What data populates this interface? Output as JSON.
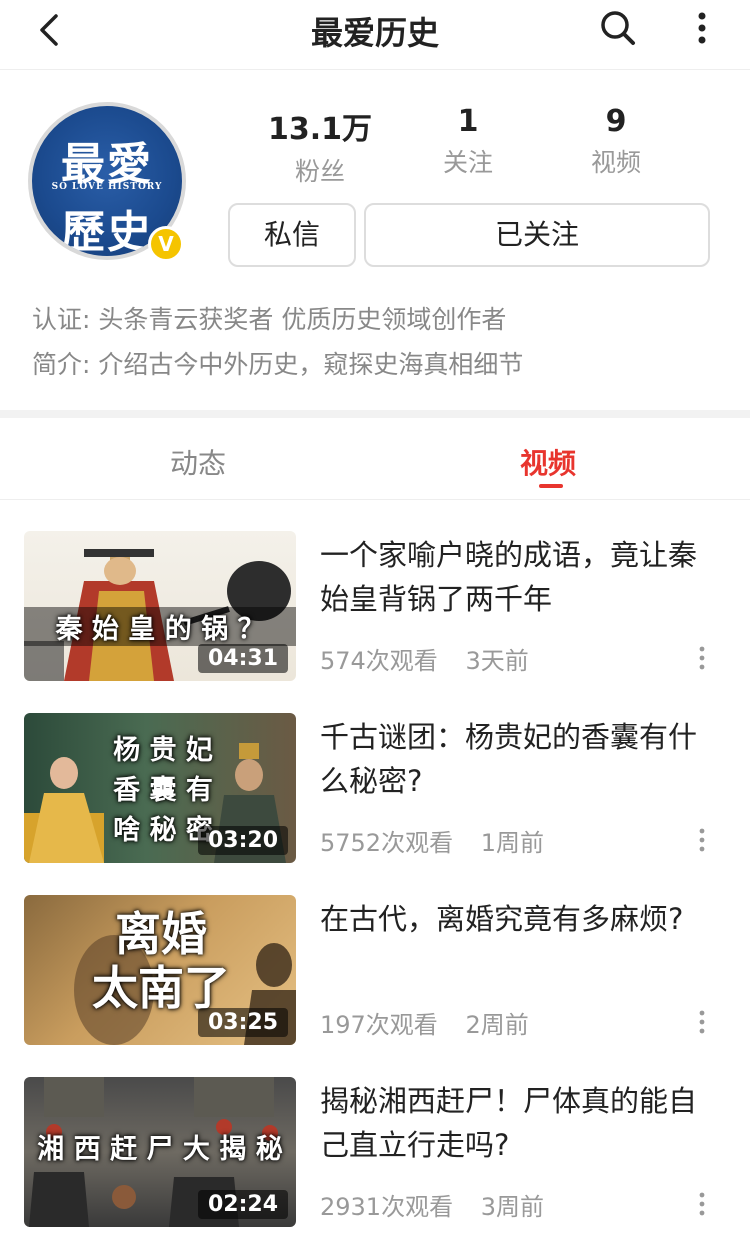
{
  "header": {
    "title": "最爱历史"
  },
  "profile": {
    "avatar": {
      "line1": "最愛",
      "line2": "SO LOVE HISTORY",
      "line3": "歷史",
      "badge": "V"
    },
    "stats": [
      {
        "value": "13.1万",
        "label": "粉丝"
      },
      {
        "value": "1",
        "label": "关注"
      },
      {
        "value": "9",
        "label": "视频"
      }
    ],
    "message_button": "私信",
    "follow_button": "已关注",
    "cert_label": "认证:",
    "cert_value": "头条青云获奖者 优质历史领域创作者",
    "intro_label": "简介:",
    "intro_value": "介绍古今中外历史，窥探史海真相细节"
  },
  "tabs": [
    {
      "label": "动态",
      "active": false
    },
    {
      "label": "视频",
      "active": true
    }
  ],
  "videos": [
    {
      "thumb_text": "秦 始 皇 的 锅 ？",
      "duration": "04:31",
      "title": "一个家喻户晓的成语，竟让秦始皇背锅了两千年",
      "views": "574次观看",
      "time": "3天前"
    },
    {
      "thumb_text": "杨 贵 妃 香 囊 有 啥 秘 密",
      "thumb_lines": [
        "杨 贵 妃",
        "香 囊 有",
        "啥 秘 密"
      ],
      "duration": "03:20",
      "title": "千古谜团：杨贵妃的香囊有什么秘密?",
      "views": "5752次观看",
      "time": "1周前"
    },
    {
      "thumb_lines": [
        "离婚",
        "太南了"
      ],
      "duration": "03:25",
      "title": "在古代，离婚究竟有多麻烦?",
      "views": "197次观看",
      "time": "2周前"
    },
    {
      "thumb_text": "湘 西 赶 尸 大 揭 秘",
      "duration": "02:24",
      "title": "揭秘湘西赶尸！尸体真的能自己直立行走吗?",
      "views": "2931次观看",
      "time": "3周前"
    }
  ],
  "colors": {
    "accent": "#e8352e",
    "badge": "#f5c400",
    "avatar_bg": "#1b4a8e"
  }
}
